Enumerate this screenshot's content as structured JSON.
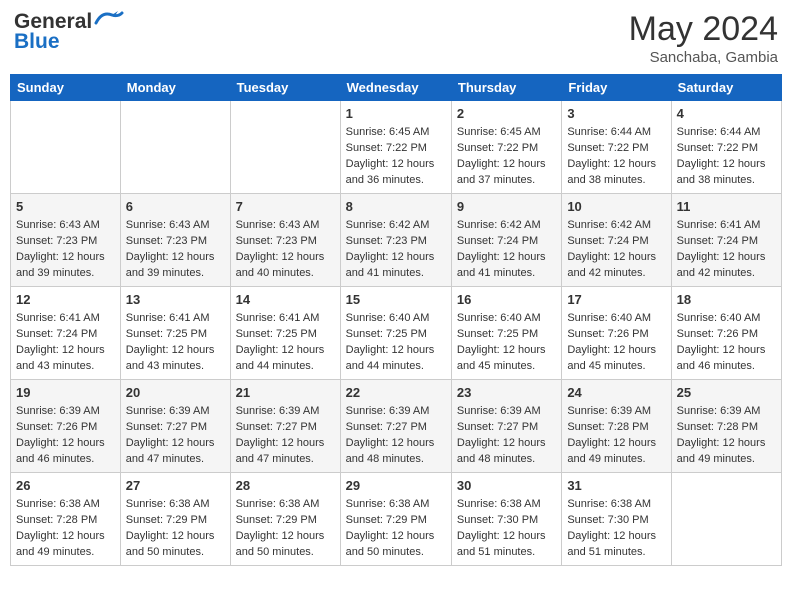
{
  "header": {
    "logo_line1": "General",
    "logo_line2": "Blue",
    "month_year": "May 2024",
    "location": "Sanchaba, Gambia"
  },
  "days_of_week": [
    "Sunday",
    "Monday",
    "Tuesday",
    "Wednesday",
    "Thursday",
    "Friday",
    "Saturday"
  ],
  "weeks": [
    [
      {
        "day": "",
        "info": ""
      },
      {
        "day": "",
        "info": ""
      },
      {
        "day": "",
        "info": ""
      },
      {
        "day": "1",
        "info": "Sunrise: 6:45 AM\nSunset: 7:22 PM\nDaylight: 12 hours\nand 36 minutes."
      },
      {
        "day": "2",
        "info": "Sunrise: 6:45 AM\nSunset: 7:22 PM\nDaylight: 12 hours\nand 37 minutes."
      },
      {
        "day": "3",
        "info": "Sunrise: 6:44 AM\nSunset: 7:22 PM\nDaylight: 12 hours\nand 38 minutes."
      },
      {
        "day": "4",
        "info": "Sunrise: 6:44 AM\nSunset: 7:22 PM\nDaylight: 12 hours\nand 38 minutes."
      }
    ],
    [
      {
        "day": "5",
        "info": "Sunrise: 6:43 AM\nSunset: 7:23 PM\nDaylight: 12 hours\nand 39 minutes."
      },
      {
        "day": "6",
        "info": "Sunrise: 6:43 AM\nSunset: 7:23 PM\nDaylight: 12 hours\nand 39 minutes."
      },
      {
        "day": "7",
        "info": "Sunrise: 6:43 AM\nSunset: 7:23 PM\nDaylight: 12 hours\nand 40 minutes."
      },
      {
        "day": "8",
        "info": "Sunrise: 6:42 AM\nSunset: 7:23 PM\nDaylight: 12 hours\nand 41 minutes."
      },
      {
        "day": "9",
        "info": "Sunrise: 6:42 AM\nSunset: 7:24 PM\nDaylight: 12 hours\nand 41 minutes."
      },
      {
        "day": "10",
        "info": "Sunrise: 6:42 AM\nSunset: 7:24 PM\nDaylight: 12 hours\nand 42 minutes."
      },
      {
        "day": "11",
        "info": "Sunrise: 6:41 AM\nSunset: 7:24 PM\nDaylight: 12 hours\nand 42 minutes."
      }
    ],
    [
      {
        "day": "12",
        "info": "Sunrise: 6:41 AM\nSunset: 7:24 PM\nDaylight: 12 hours\nand 43 minutes."
      },
      {
        "day": "13",
        "info": "Sunrise: 6:41 AM\nSunset: 7:25 PM\nDaylight: 12 hours\nand 43 minutes."
      },
      {
        "day": "14",
        "info": "Sunrise: 6:41 AM\nSunset: 7:25 PM\nDaylight: 12 hours\nand 44 minutes."
      },
      {
        "day": "15",
        "info": "Sunrise: 6:40 AM\nSunset: 7:25 PM\nDaylight: 12 hours\nand 44 minutes."
      },
      {
        "day": "16",
        "info": "Sunrise: 6:40 AM\nSunset: 7:25 PM\nDaylight: 12 hours\nand 45 minutes."
      },
      {
        "day": "17",
        "info": "Sunrise: 6:40 AM\nSunset: 7:26 PM\nDaylight: 12 hours\nand 45 minutes."
      },
      {
        "day": "18",
        "info": "Sunrise: 6:40 AM\nSunset: 7:26 PM\nDaylight: 12 hours\nand 46 minutes."
      }
    ],
    [
      {
        "day": "19",
        "info": "Sunrise: 6:39 AM\nSunset: 7:26 PM\nDaylight: 12 hours\nand 46 minutes."
      },
      {
        "day": "20",
        "info": "Sunrise: 6:39 AM\nSunset: 7:27 PM\nDaylight: 12 hours\nand 47 minutes."
      },
      {
        "day": "21",
        "info": "Sunrise: 6:39 AM\nSunset: 7:27 PM\nDaylight: 12 hours\nand 47 minutes."
      },
      {
        "day": "22",
        "info": "Sunrise: 6:39 AM\nSunset: 7:27 PM\nDaylight: 12 hours\nand 48 minutes."
      },
      {
        "day": "23",
        "info": "Sunrise: 6:39 AM\nSunset: 7:27 PM\nDaylight: 12 hours\nand 48 minutes."
      },
      {
        "day": "24",
        "info": "Sunrise: 6:39 AM\nSunset: 7:28 PM\nDaylight: 12 hours\nand 49 minutes."
      },
      {
        "day": "25",
        "info": "Sunrise: 6:39 AM\nSunset: 7:28 PM\nDaylight: 12 hours\nand 49 minutes."
      }
    ],
    [
      {
        "day": "26",
        "info": "Sunrise: 6:38 AM\nSunset: 7:28 PM\nDaylight: 12 hours\nand 49 minutes."
      },
      {
        "day": "27",
        "info": "Sunrise: 6:38 AM\nSunset: 7:29 PM\nDaylight: 12 hours\nand 50 minutes."
      },
      {
        "day": "28",
        "info": "Sunrise: 6:38 AM\nSunset: 7:29 PM\nDaylight: 12 hours\nand 50 minutes."
      },
      {
        "day": "29",
        "info": "Sunrise: 6:38 AM\nSunset: 7:29 PM\nDaylight: 12 hours\nand 50 minutes."
      },
      {
        "day": "30",
        "info": "Sunrise: 6:38 AM\nSunset: 7:30 PM\nDaylight: 12 hours\nand 51 minutes."
      },
      {
        "day": "31",
        "info": "Sunrise: 6:38 AM\nSunset: 7:30 PM\nDaylight: 12 hours\nand 51 minutes."
      },
      {
        "day": "",
        "info": ""
      }
    ]
  ]
}
